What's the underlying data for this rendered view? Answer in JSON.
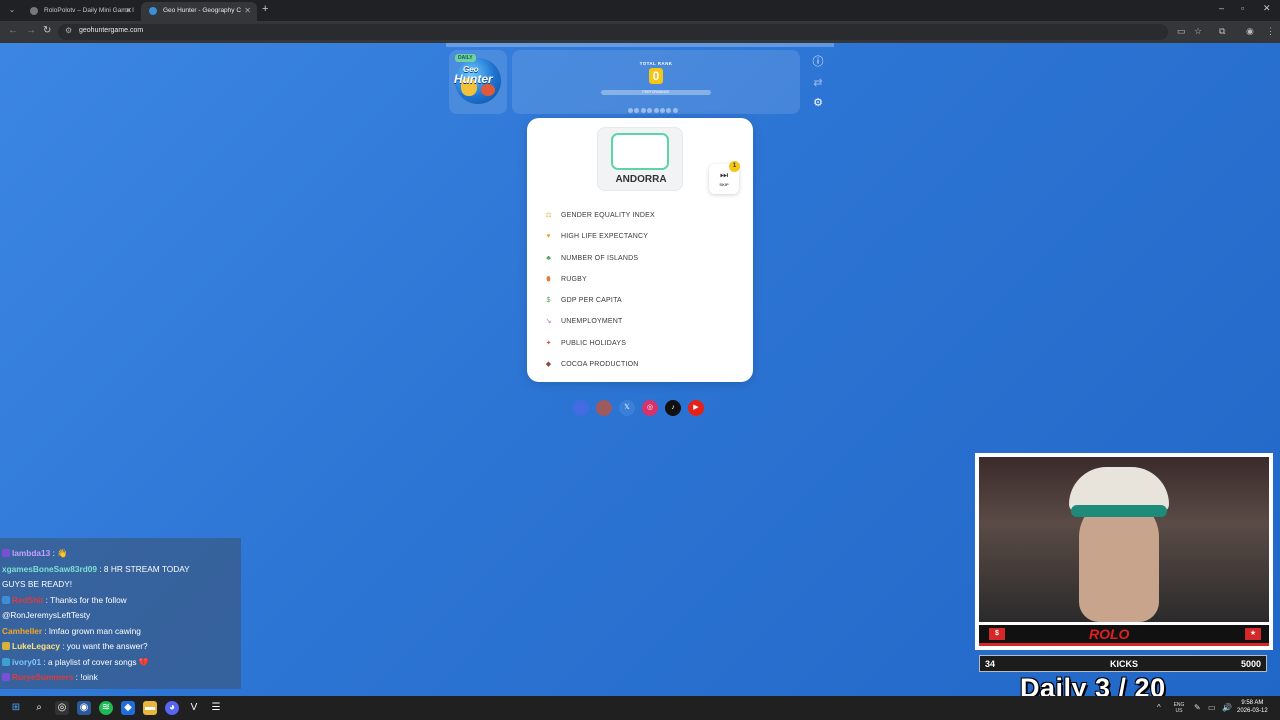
{
  "browser": {
    "tabs": [
      {
        "title": "RoloPolotv – Daily Mini Game I",
        "active": false
      },
      {
        "title": "Geo Hunter - Geography C",
        "active": true
      }
    ],
    "url": "geohuntergame.com"
  },
  "logo": {
    "badge": "DAILY",
    "line1": "Geo",
    "line2": "Hunter"
  },
  "rank": {
    "label": "TOTAL RANK",
    "value": "0",
    "performance_label": "PERFORMANCE",
    "progress_dots": 8
  },
  "side_icons": [
    "info-icon",
    "refresh-icon",
    "gear-icon"
  ],
  "country": {
    "name": "ANDORRA"
  },
  "skip": {
    "label": "SKIP",
    "count": "1"
  },
  "categories": [
    {
      "label": "GENDER EQUALITY INDEX",
      "icon": "balance-icon",
      "color": "#f0b44c"
    },
    {
      "label": "HIGH LIFE EXPECTANCY",
      "icon": "heart-icon",
      "color": "#e8a33d"
    },
    {
      "label": "NUMBER OF ISLANDS",
      "icon": "palm-icon",
      "color": "#4a9b4f"
    },
    {
      "label": "RUGBY",
      "icon": "rugby-ball-icon",
      "color": "#e07a3a"
    },
    {
      "label": "GDP PER CAPITA",
      "icon": "money-icon",
      "color": "#4caf50"
    },
    {
      "label": "UNEMPLOYMENT",
      "icon": "chart-down-icon",
      "color": "#b06ab3"
    },
    {
      "label": "PUBLIC HOLIDAYS",
      "icon": "party-icon",
      "color": "#d9534f"
    },
    {
      "label": "COCOA PRODUCTION",
      "icon": "chocolate-icon",
      "color": "#8b4a3a"
    }
  ],
  "socials": [
    {
      "name": "discord-icon",
      "color": "#5865f2",
      "glyph": ""
    },
    {
      "name": "reddit-icon",
      "color": "#ff4500",
      "glyph": ""
    },
    {
      "name": "x-icon",
      "color": "#3b7fd8",
      "glyph": "𝕏"
    },
    {
      "name": "instagram-icon",
      "color": "#d6336c",
      "glyph": "◎"
    },
    {
      "name": "tiktok-icon",
      "color": "#111111",
      "glyph": "♪"
    },
    {
      "name": "youtube-icon",
      "color": "#e62117",
      "glyph": "▶"
    }
  ],
  "chat": [
    {
      "user": "lambda13",
      "user_color": "#c9a0ff",
      "text": " : 👋",
      "badge": "#7a4fd6"
    },
    {
      "user": "xgamesBoneSaw83rd09",
      "user_color": "#7ce0d2",
      "text": " : 8 HR STREAM TODAY",
      "badge": "",
      "wrap": "GUYS BE READY!"
    },
    {
      "user": "RedShit",
      "user_color": "#e03a3a",
      "text": " : Thanks for the follow",
      "badge": "#3a8fd6",
      "wrap": "@RonJeremysLeftTesty"
    },
    {
      "user": "Camheller",
      "user_color": "#f5a623",
      "text": " : lmfao grown man cawing",
      "badge": ""
    },
    {
      "user": "LukeLegacy",
      "user_color": "#ffe17a",
      "text": " : you want the answer?",
      "badge": "#d6b23a"
    },
    {
      "user": "ivory01",
      "user_color": "#7fc7ff",
      "text": " : a playlist of cover songs 💔",
      "badge": "#3aa0d6"
    },
    {
      "user": "RoryeSummers",
      "user_color": "#e03a3a",
      "text": " : !oink",
      "badge": "#7a4fd6"
    }
  ],
  "webcam": {
    "brand": "ROLO",
    "s_badge": "$",
    "star": "★"
  },
  "kicks": {
    "left": "34",
    "label": "KICKS",
    "right": "5000"
  },
  "overlay": {
    "daily_text": "Daily  3 / 20"
  },
  "taskbar": {
    "clock_time": "9:58 AM",
    "clock_date": "2026-03-12",
    "lang": "ENG US"
  }
}
